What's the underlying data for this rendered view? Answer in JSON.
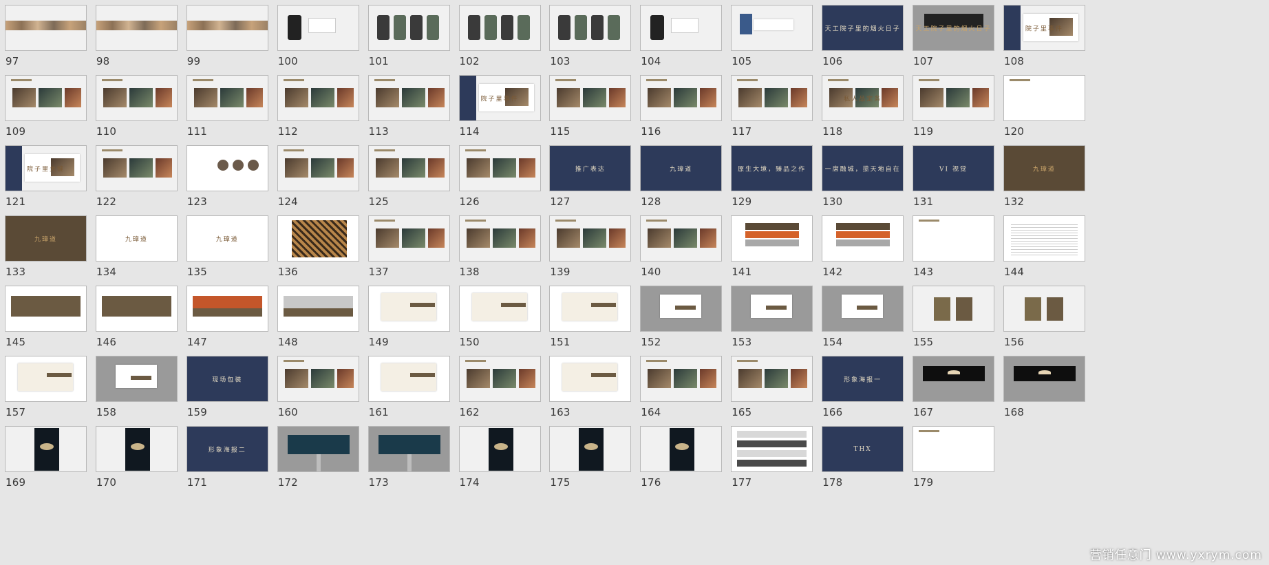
{
  "slides": [
    {
      "n": "97",
      "s": "strip"
    },
    {
      "n": "98",
      "s": "strip"
    },
    {
      "n": "99",
      "s": "strip"
    },
    {
      "n": "100",
      "s": "phone1"
    },
    {
      "n": "101",
      "s": "phones"
    },
    {
      "n": "102",
      "s": "phones"
    },
    {
      "n": "103",
      "s": "phones"
    },
    {
      "n": "104",
      "s": "phone1"
    },
    {
      "n": "105",
      "s": "card"
    },
    {
      "n": "106",
      "s": "navy",
      "c": "天工院子里的烟火日子"
    },
    {
      "n": "107",
      "s": "billboard",
      "c": "天工院子里的烟火日子"
    },
    {
      "n": "108",
      "s": "navyphoto",
      "c": "院子里事件"
    },
    {
      "n": "109",
      "s": "photos"
    },
    {
      "n": "110",
      "s": "photos"
    },
    {
      "n": "111",
      "s": "photos"
    },
    {
      "n": "112",
      "s": "photos"
    },
    {
      "n": "113",
      "s": "photos"
    },
    {
      "n": "114",
      "s": "navyphoto",
      "c": "院子里事件"
    },
    {
      "n": "115",
      "s": "photos"
    },
    {
      "n": "116",
      "s": "photos"
    },
    {
      "n": "117",
      "s": "photos"
    },
    {
      "n": "118",
      "s": "photos",
      "c": "私人品定务"
    },
    {
      "n": "119",
      "s": "photos"
    },
    {
      "n": "120",
      "s": "white"
    },
    {
      "n": "121",
      "s": "navyphoto",
      "c": "院子里关键"
    },
    {
      "n": "122",
      "s": "photos"
    },
    {
      "n": "123",
      "s": "circles"
    },
    {
      "n": "124",
      "s": "photos"
    },
    {
      "n": "125",
      "s": "photos"
    },
    {
      "n": "126",
      "s": "photos"
    },
    {
      "n": "127",
      "s": "navy",
      "c": "推广表达"
    },
    {
      "n": "128",
      "s": "navy",
      "c": "九璋道"
    },
    {
      "n": "129",
      "s": "navy",
      "c": "原生大境，臻品之作"
    },
    {
      "n": "130",
      "s": "navy",
      "c": "一席融城，揽天地自在"
    },
    {
      "n": "131",
      "s": "navy",
      "c": "VI 视觉"
    },
    {
      "n": "132",
      "s": "brown",
      "c": "九璋道"
    },
    {
      "n": "133",
      "s": "brown",
      "c": "九璋道"
    },
    {
      "n": "134",
      "s": "whitelogo",
      "c": "九璋道"
    },
    {
      "n": "135",
      "s": "whitelogo",
      "c": "九璋道"
    },
    {
      "n": "136",
      "s": "lattice"
    },
    {
      "n": "137",
      "s": "photos"
    },
    {
      "n": "138",
      "s": "photos"
    },
    {
      "n": "139",
      "s": "photos"
    },
    {
      "n": "140",
      "s": "photos"
    },
    {
      "n": "141",
      "s": "swatch"
    },
    {
      "n": "142",
      "s": "swatch"
    },
    {
      "n": "143",
      "s": "white"
    },
    {
      "n": "144",
      "s": "text"
    },
    {
      "n": "145",
      "s": "brownbar"
    },
    {
      "n": "146",
      "s": "brownbar"
    },
    {
      "n": "147",
      "s": "orangebar"
    },
    {
      "n": "148",
      "s": "graybar"
    },
    {
      "n": "149",
      "s": "mock"
    },
    {
      "n": "150",
      "s": "mock"
    },
    {
      "n": "151",
      "s": "mock"
    },
    {
      "n": "152",
      "s": "graymock"
    },
    {
      "n": "153",
      "s": "graymock"
    },
    {
      "n": "154",
      "s": "graymock"
    },
    {
      "n": "155",
      "s": "bags"
    },
    {
      "n": "156",
      "s": "bags"
    },
    {
      "n": "157",
      "s": "mock"
    },
    {
      "n": "158",
      "s": "graymock"
    },
    {
      "n": "159",
      "s": "navy",
      "c": "现场包装"
    },
    {
      "n": "160",
      "s": "photos"
    },
    {
      "n": "161",
      "s": "mock"
    },
    {
      "n": "162",
      "s": "photos"
    },
    {
      "n": "163",
      "s": "mock"
    },
    {
      "n": "164",
      "s": "photos"
    },
    {
      "n": "165",
      "s": "photos"
    },
    {
      "n": "166",
      "s": "navy",
      "c": "形象海报一"
    },
    {
      "n": "167",
      "s": "darkbb"
    },
    {
      "n": "168",
      "s": "darkbb"
    },
    {
      "n": "169",
      "s": "poster"
    },
    {
      "n": "170",
      "s": "poster"
    },
    {
      "n": "171",
      "s": "navy",
      "c": "形象海报二"
    },
    {
      "n": "172",
      "s": "graybb"
    },
    {
      "n": "173",
      "s": "graybb"
    },
    {
      "n": "174",
      "s": "poster"
    },
    {
      "n": "175",
      "s": "poster"
    },
    {
      "n": "176",
      "s": "poster"
    },
    {
      "n": "177",
      "s": "table"
    },
    {
      "n": "178",
      "s": "navy",
      "c": "THX"
    },
    {
      "n": "179",
      "s": "white"
    }
  ],
  "watermark": "营销任意门 www.yxrym.com"
}
